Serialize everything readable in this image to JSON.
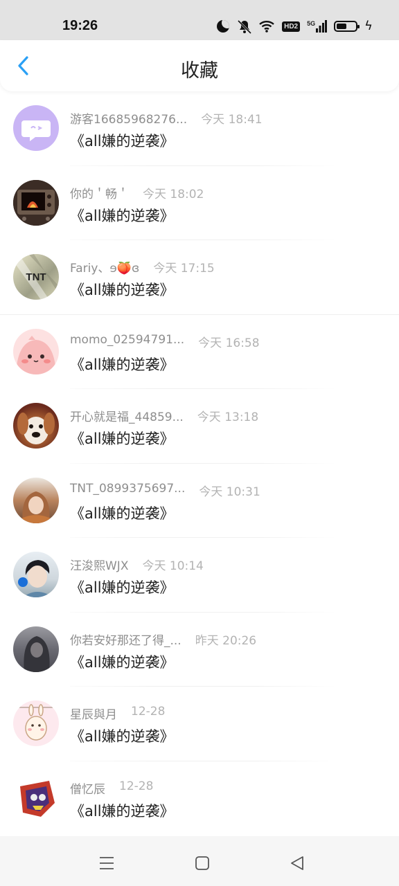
{
  "status_bar": {
    "time": "19:26",
    "icons": [
      "moon-icon",
      "bell-muted-icon",
      "wifi-icon",
      "hd2-icon",
      "5g-signal-icon",
      "battery-icon",
      "charging-icon"
    ],
    "hd_label": "HD2",
    "network_label": "5G"
  },
  "header": {
    "title": "收藏",
    "back_icon": "chevron-left-icon",
    "accent_color": "#2aa0f5"
  },
  "favorites": [
    {
      "name": "游客16685968276...",
      "time": "今天 18:41",
      "message": "《all嫌的逆袭》"
    },
    {
      "name": "你的＇畅＇",
      "time": "今天 18:02",
      "message": "《all嫌的逆袭》"
    },
    {
      "name": "Fariy、ɘ🍑ɞ",
      "time": "今天 17:15",
      "message": "《all嫌的逆袭》",
      "avatar_text": "TNT"
    },
    {
      "name": "momo_02594791...",
      "time": "今天 16:58",
      "message": "《all嫌的逆袭》"
    },
    {
      "name": "开心就是福_44859...",
      "time": "今天 13:18",
      "message": "《all嫌的逆袭》"
    },
    {
      "name": "TNT_0899375697...",
      "time": "今天 10:31",
      "message": "《all嫌的逆袭》"
    },
    {
      "name": "汪浚熙WJX",
      "time": "今天 10:14",
      "message": "《all嫌的逆袭》"
    },
    {
      "name": "你若安好那还了得_...",
      "time": "昨天 20:26",
      "message": "《all嫌的逆袭》"
    },
    {
      "name": "星辰與月",
      "time": "12-28",
      "message": "《all嫌的逆袭》"
    },
    {
      "name": "僧忆辰",
      "time": "12-28",
      "message": "《all嫌的逆袭》"
    }
  ],
  "nav_bar": {
    "icons": [
      "menu-icon",
      "home-square-icon",
      "back-triangle-icon"
    ]
  }
}
